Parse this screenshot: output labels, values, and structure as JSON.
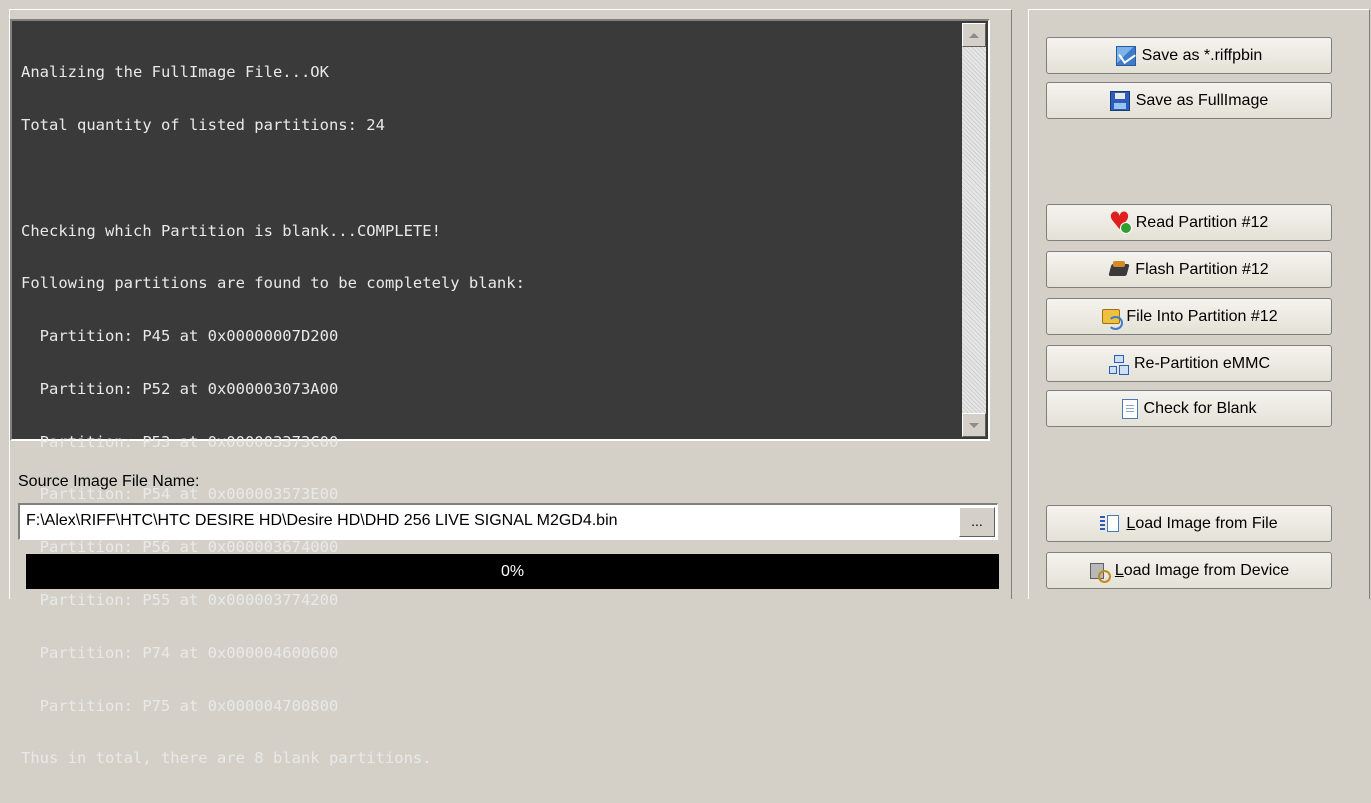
{
  "console": {
    "lines": [
      "Analizing the FullImage File...OK",
      "Total quantity of listed partitions: 24",
      "",
      "Checking which Partition is blank...COMPLETE!",
      "Following partitions are found to be completely blank:",
      "  Partition: P45 at 0x00000007D200",
      "  Partition: P52 at 0x000003073A00",
      "  Partition: P53 at 0x000003373C00",
      "  Partition: P54 at 0x000003573E00",
      "  Partition: P56 at 0x000003674000",
      "  Partition: P55 at 0x000003774200",
      "  Partition: P74 at 0x000004600600",
      "  Partition: P75 at 0x000004700800",
      "Thus in total, there are 8 blank partitions."
    ]
  },
  "source": {
    "label": "Source Image File Name:",
    "path": "F:\\Alex\\RIFF\\HTC\\HTC DESIRE HD\\Desire HD\\DHD 256 LIVE SIGNAL M2GD4.bin",
    "browse_label": "..."
  },
  "progress": {
    "value": 0,
    "text": "0%"
  },
  "buttons": {
    "save_riffpbin": "Save as *.riffpbin",
    "save_fullimage": "Save as FullImage",
    "read_partition": "Read Partition #12",
    "flash_partition": "Flash Partition #12",
    "file_into_partition": "File Into Partition #12",
    "repartition": "Re-Partition eMMC",
    "check_blank": "Check for Blank",
    "load_from_file": "Load Image from File",
    "load_from_device": "Load Image from Device"
  },
  "icons": {
    "save_riffpbin": "save-riff-icon",
    "save_fullimage": "floppy-disk-icon",
    "read_partition": "heart-icon",
    "flash_partition": "chip-icon",
    "file_into_partition": "file-transfer-icon",
    "repartition": "network-tree-icon",
    "check_blank": "document-icon",
    "load_from_file": "load-file-icon",
    "load_from_device": "load-device-icon"
  },
  "colors": {
    "console_bg": "#3a3a3a",
    "console_text": "#e9e9e9",
    "window_bg": "#d4d0c8",
    "progress_bg": "#000000"
  }
}
